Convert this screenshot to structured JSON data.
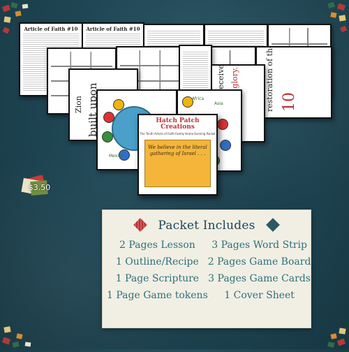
{
  "price": "$3.50",
  "packet": {
    "title": "Packet Includes",
    "items": [
      "2 Pages Lesson",
      "3 Pages Word Strip",
      "1 Outline/Recipe",
      "2 Pages Game Board",
      "1 Page Scripture",
      "3 Pages Game Cards",
      "1 Page Game tokens",
      "1 Cover Sheet"
    ]
  },
  "sheets": {
    "article_left": "Article of Faith #10",
    "article_right": "Article of Faith #10"
  },
  "word_strips": {
    "strip_a": "Zion",
    "strip_b": "built upon",
    "strip_c": "renewed & receive its",
    "strip_d": "paradisiacal glory.",
    "strip_e": "restoration of the",
    "strip_f": "10"
  },
  "board_labels": {
    "asia": "Asia",
    "africa": "Africa",
    "mexico": "Mexico"
  },
  "cover": {
    "brand": "Hatch Patch Creations",
    "subtitle": "The Tenth Article of Faith Family Home Evening Packet",
    "quote": "We believe in the literal gathering of Israel . . ."
  },
  "colors": {
    "background": "#1f4654",
    "panel": "#f1efe4",
    "panel_text": "#2e6f7b",
    "cover_gold": "#f4b53a"
  }
}
